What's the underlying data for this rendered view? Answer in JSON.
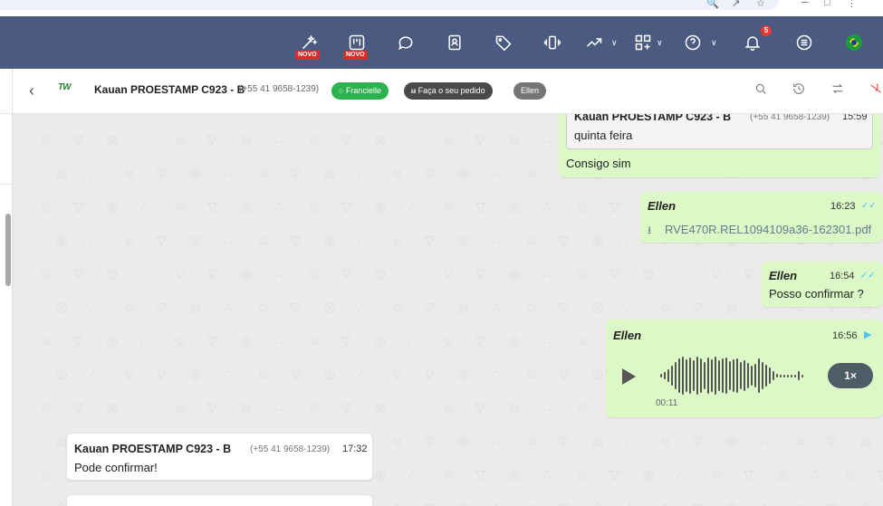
{
  "topbar": {
    "novo_label": "NOVO",
    "notification_count": "5"
  },
  "chat_header": {
    "contact_name": "Kauan PROESTAMP C923 - B",
    "contact_phone": "(+55 41 9658-1239)",
    "logo_text": "TW",
    "tags": {
      "agent": "Francielle",
      "order": "Faça o seu pedido",
      "user": "Ellen"
    }
  },
  "messages": [
    {
      "direction": "out",
      "quoted": {
        "sender": "Kauan PROESTAMP C923 - B",
        "phone": "(+55 41 9658-1239)",
        "time": "15:59",
        "text": "quinta feira"
      },
      "text": "Consigo sim"
    },
    {
      "direction": "out",
      "sender": "Ellen",
      "time": "16:23",
      "file_name": "RVE470R.REL1094109a36-162301.pdf"
    },
    {
      "direction": "out",
      "sender": "Ellen",
      "time": "16:54",
      "text": "Posso confirmar ?"
    },
    {
      "direction": "out",
      "sender": "Ellen",
      "time": "16:56",
      "audio_duration": "00:11",
      "speed": "1×"
    },
    {
      "direction": "in",
      "sender": "Kauan PROESTAMP C923 - B",
      "phone": "(+55 41 9658-1239)",
      "time": "17:32",
      "text": "Pode confirmar!"
    }
  ],
  "colors": {
    "topbar": "#4a5a80",
    "outgoing_bubble": "#dcf8c6",
    "incoming_bubble": "#ffffff",
    "tag_green": "#2bb24c",
    "badge_red": "#d32f2f"
  }
}
